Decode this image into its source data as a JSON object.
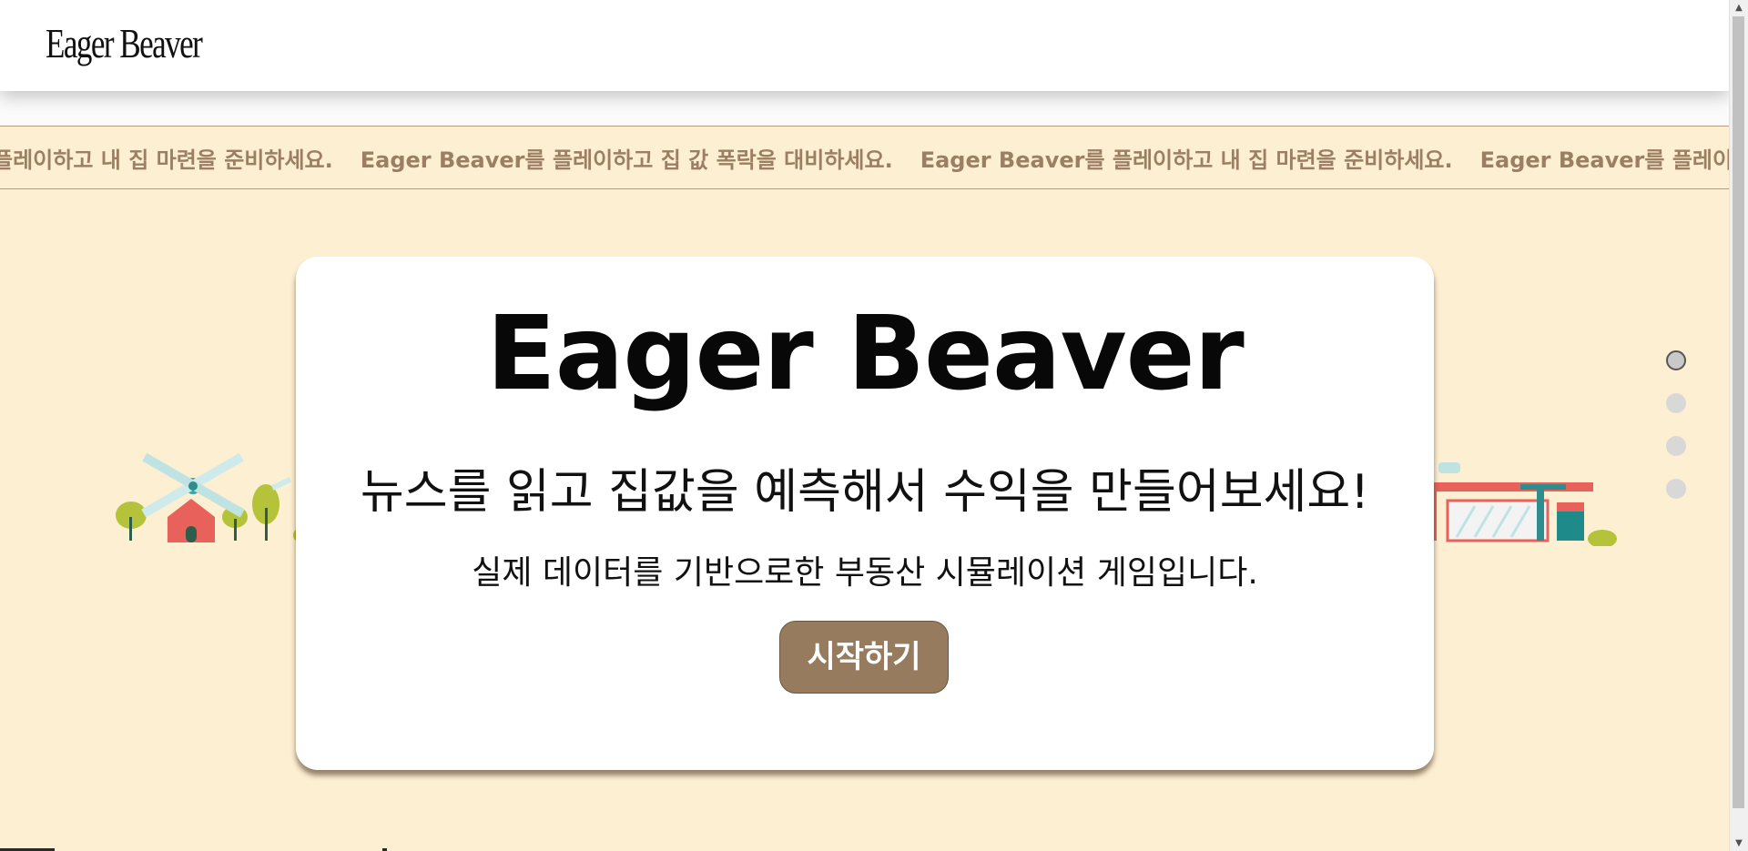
{
  "header": {
    "logo_text": "Eager Beaver"
  },
  "marquee": {
    "items": [
      "플레이하고 내 집 마련을 준비하세요.",
      "Eager Beaver를 플레이하고 집 값 폭락을 대비하세요.",
      "Eager Beaver를 플레이하고 내 집 마련을 준비하세요.",
      "Eager Beaver를 플레이하고 집 값 폭락을 대비하세요."
    ]
  },
  "hero": {
    "title": "Eager Beaver",
    "subtitle": "뉴스를 읽고 집값을 예측해서 수익을 만들어보세요!",
    "description": "실제 데이터를 기반으로한 부동산 시뮬레이션 게임입니다.",
    "start_button_label": "시작하기"
  },
  "page_dots": {
    "count": 4,
    "active_index": 0
  },
  "icons": {
    "left_scene": "windmill-farm-icon",
    "right_scene": "gas-station-icon"
  },
  "colors": {
    "background": "#fdefd2",
    "marquee_text": "#9c7f63",
    "button": "#967b5e"
  }
}
